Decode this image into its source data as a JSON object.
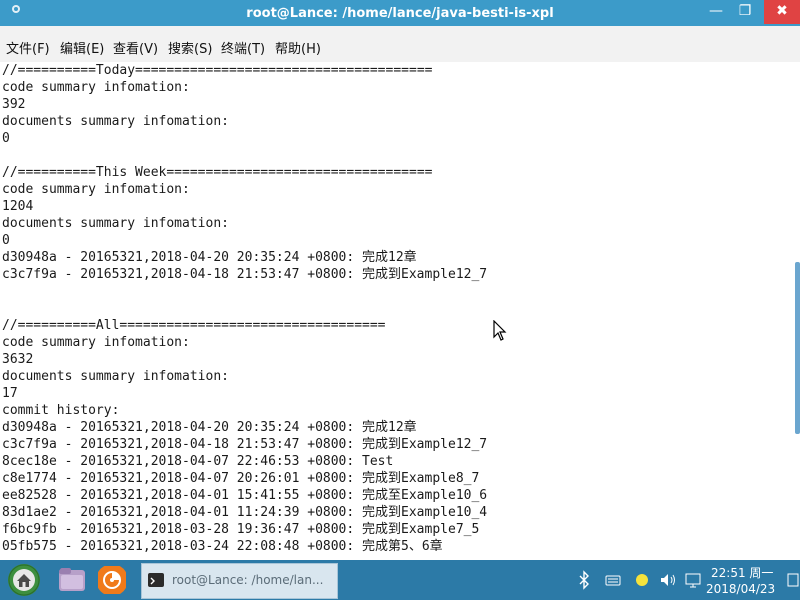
{
  "window": {
    "title": "root@Lance: /home/lance/java-besti-is-xpl",
    "min_glyph": "—",
    "max_glyph": "❐",
    "close_glyph": "✖"
  },
  "menubar": {
    "items": [
      "文件(F)",
      "编辑(E)",
      "查看(V)",
      "搜索(S)",
      "终端(T)",
      "帮助(H)"
    ]
  },
  "terminal": {
    "lines": [
      "//==========Today======================================",
      "code summary infomation:",
      "392",
      "documents summary infomation:",
      "0",
      "",
      "//==========This Week==================================",
      "code summary infomation:",
      "1204",
      "documents summary infomation:",
      "0",
      "d30948a - 20165321,2018-04-20 20:35:24 +0800: 完成12章",
      "c3c7f9a - 20165321,2018-04-18 21:53:47 +0800: 完成到Example12_7",
      "",
      "",
      "//==========All==================================",
      "code summary infomation:",
      "3632",
      "documents summary infomation:",
      "17",
      "commit history:",
      "d30948a - 20165321,2018-04-20 20:35:24 +0800: 完成12章",
      "c3c7f9a - 20165321,2018-04-18 21:53:47 +0800: 完成到Example12_7",
      "8cec18e - 20165321,2018-04-07 22:46:53 +0800: Test",
      "c8e1774 - 20165321,2018-04-07 20:26:01 +0800: 完成到Example8_7",
      "ee82528 - 20165321,2018-04-01 15:41:55 +0800: 完成至Example10_6",
      "83d1ae2 - 20165321,2018-04-01 11:24:39 +0800: 完成到Example10_4",
      "f6bc9fb - 20165321,2018-03-28 19:36:47 +0800: 完成到Example7_5",
      "05fb575 - 20165321,2018-03-24 22:08:48 +0800: 完成第5、6章"
    ]
  },
  "taskbar": {
    "window_label": "root@Lance: /home/lan...",
    "time": "22:51 周一",
    "date": "2018/04/23",
    "tray_icons": [
      "bluetooth-icon",
      "keyboard-icon",
      "weather-icon",
      "volume-icon",
      "network-icon",
      "notification-icon"
    ]
  },
  "colors": {
    "titlebar": "#3c9bc9",
    "taskbar": "#2c7aa7",
    "close_button": "#e04343"
  }
}
